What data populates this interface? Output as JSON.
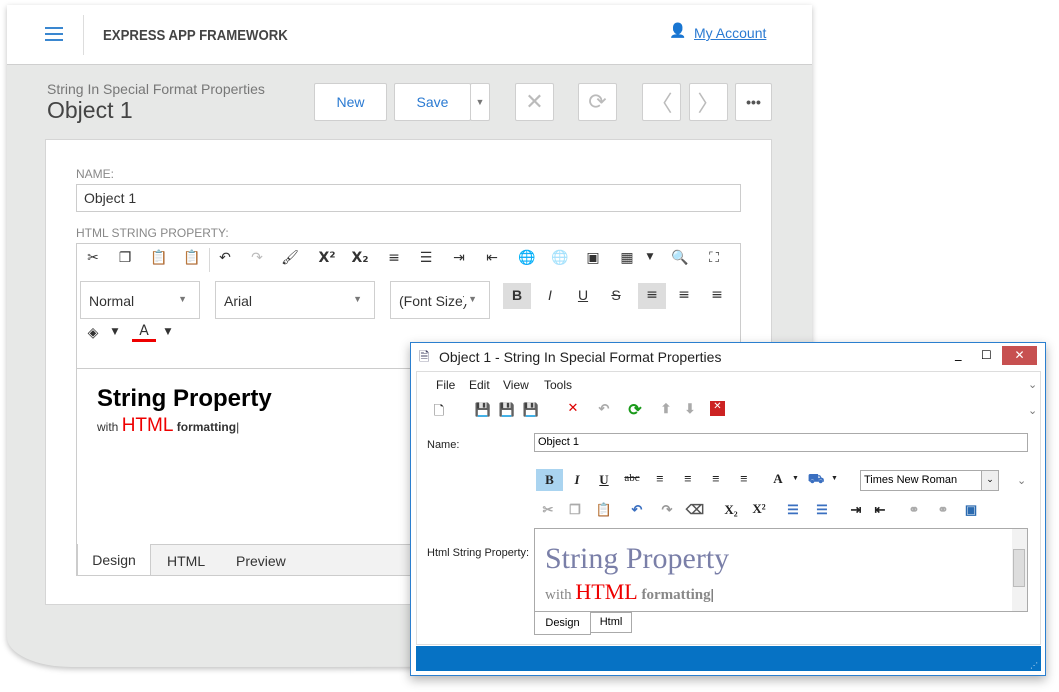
{
  "web": {
    "app_title": "EXPRESS APP FRAMEWORK",
    "account_link": "My Account",
    "subtitle": "String In Special Format Properties",
    "title": "Object 1",
    "buttons": {
      "new": "New",
      "save": "Save"
    },
    "name_label": "NAME:",
    "name_value": "Object 1",
    "html_label": "HTML STRING PROPERTY:",
    "style_select": "Normal",
    "font_select": "Arial",
    "size_select": "(Font Size)",
    "content": {
      "heading": "String Property",
      "with": "with",
      "html": "HTML",
      "formatting": "formatting"
    },
    "tabs": [
      "Design",
      "HTML",
      "Preview"
    ],
    "colors": {
      "accent": "#2a7ad2",
      "background": "#e7e8e7"
    }
  },
  "win": {
    "title": "Object 1 - String In Special Format Properties",
    "menu": [
      "File",
      "Edit",
      "View",
      "Tools"
    ],
    "name_label": "Name:",
    "name_value": "Object 1",
    "font_combo": "Times New Roman",
    "html_label": "Html String Property:",
    "content": {
      "heading": "String Property",
      "with": "with",
      "html": "HTML",
      "formatting": "formatting"
    },
    "tabs": [
      "Design",
      "Html"
    ],
    "colors": {
      "status_bar": "#0672c4",
      "close": "#c75050"
    }
  }
}
